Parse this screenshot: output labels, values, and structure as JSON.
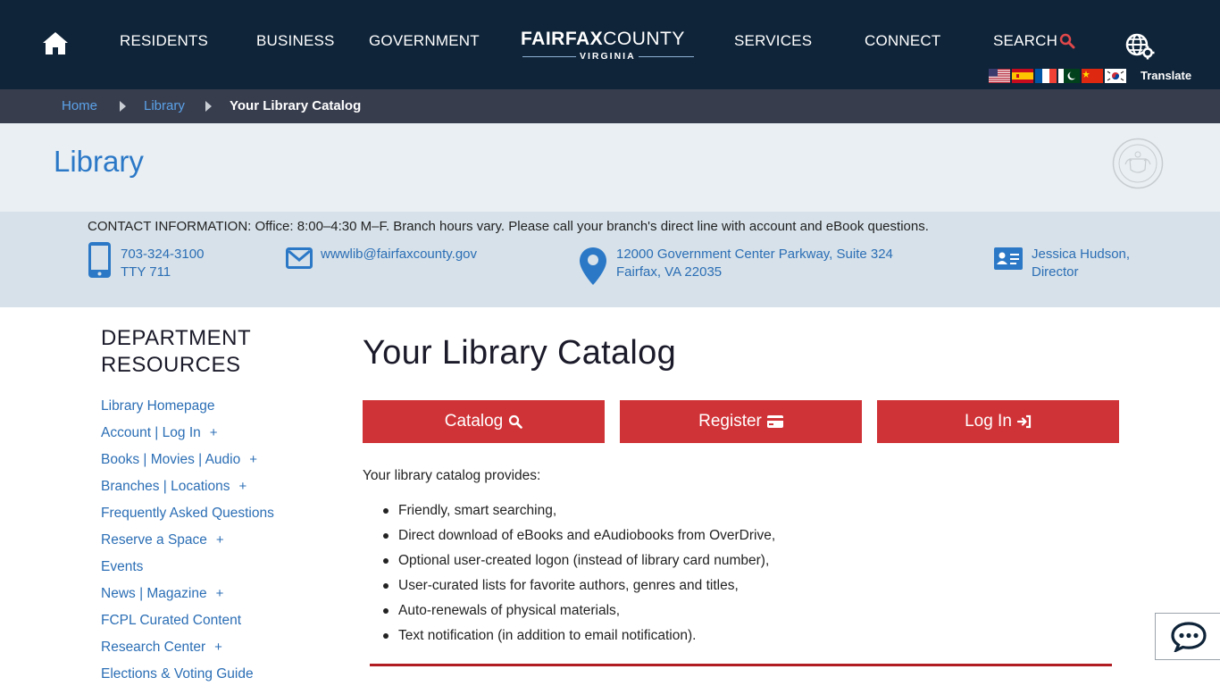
{
  "nav": {
    "items": [
      "RESIDENTS",
      "BUSINESS",
      "GOVERNMENT",
      "SERVICES",
      "CONNECT"
    ],
    "search_label": "SEARCH",
    "logo_fairfax": "FAIRFAX",
    "logo_county": "COUNTY",
    "logo_virginia": "VIRGINIA",
    "translate_label": "Translate",
    "flags": [
      "us-flag-icon",
      "spain-flag-icon",
      "france-flag-icon",
      "pakistan-flag-icon",
      "china-flag-icon",
      "korea-flag-icon"
    ]
  },
  "breadcrumb": {
    "home": "Home",
    "library": "Library",
    "current": "Your Library Catalog"
  },
  "banner": {
    "title": "Library"
  },
  "contact": {
    "info": "CONTACT INFORMATION: Office: 8:00–4:30 M–F. Branch hours vary. Please call your branch's direct line with account and eBook questions.",
    "phone": "703-324-3100",
    "tty": "TTY 711",
    "email": "wwwlib@fairfaxcounty.gov",
    "address_line1": "12000 Government Center Parkway, Suite 324",
    "address_line2": "Fairfax, VA 22035",
    "director_name": "Jessica Hudson,",
    "director_title": "Director"
  },
  "sidebar": {
    "title_line1": "DEPARTMENT",
    "title_line2": "RESOURCES",
    "items": [
      {
        "label": "Library Homepage",
        "expandable": false
      },
      {
        "label": "Account | Log In",
        "expandable": true
      },
      {
        "label": "Books | Movies | Audio",
        "expandable": true
      },
      {
        "label": "Branches | Locations",
        "expandable": true
      },
      {
        "label": "Frequently Asked Questions",
        "expandable": false
      },
      {
        "label": "Reserve a Space",
        "expandable": true
      },
      {
        "label": "Events",
        "expandable": false
      },
      {
        "label": "News | Magazine",
        "expandable": true
      },
      {
        "label": "FCPL Curated Content",
        "expandable": false
      },
      {
        "label": "Research Center",
        "expandable": true
      },
      {
        "label": "Elections & Voting Guide",
        "expandable": false
      }
    ],
    "plus": "+"
  },
  "main": {
    "title": "Your Library Catalog",
    "buttons": {
      "catalog": "Catalog",
      "register": "Register",
      "login": "Log In"
    },
    "intro": "Your library catalog provides:",
    "features": [
      "Friendly, smart searching,",
      "Direct download of eBooks and eAudiobooks from OverDrive,",
      "Optional user-created logon (instead of library card number),",
      "User-curated lists for favorite authors, genres and titles,",
      "Auto-renewals of physical materials,",
      "Text notification (in addition to email notification)."
    ]
  },
  "colors": {
    "nav_bg": "#0f2439",
    "breadcrumb_bg": "#383d4e",
    "banner_bg": "#e9eff3",
    "contact_bg": "#d6e1e9",
    "link": "#2b6eb5",
    "button_red": "#d03337",
    "divider_red": "#b01c22",
    "search_accent": "#e0484a"
  }
}
